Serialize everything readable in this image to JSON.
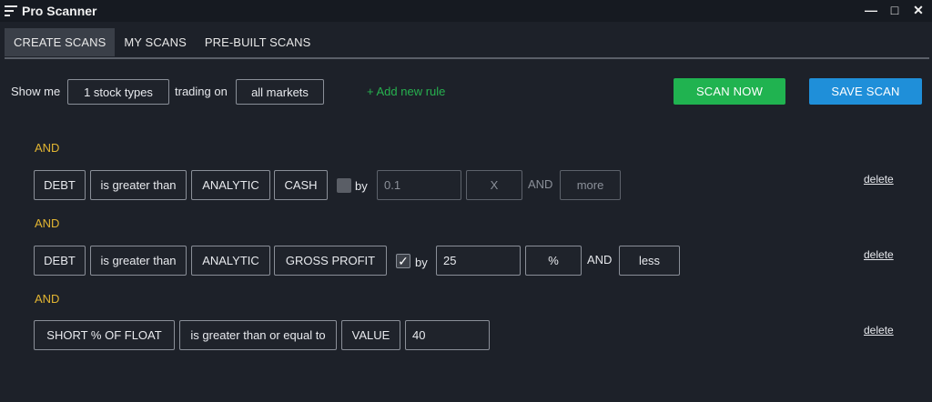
{
  "window": {
    "title": "Pro Scanner",
    "minimize": "—",
    "maximize": "□",
    "close": "✕"
  },
  "tabs": [
    {
      "label": "CREATE SCANS",
      "active": true
    },
    {
      "label": "MY SCANS",
      "active": false
    },
    {
      "label": "PRE-BUILT SCANS",
      "active": false
    }
  ],
  "toolbar": {
    "show_me": "Show me",
    "stock_types": "1 stock types",
    "trading_on": "trading on",
    "markets": "all markets",
    "add_rule": "+ Add new rule",
    "scan_now": "SCAN NOW",
    "save_scan": "SAVE SCAN"
  },
  "rules": [
    {
      "connector": "AND",
      "field": "DEBT",
      "operator": "is greater than",
      "compare_type": "ANALYTIC",
      "compare_field": "CASH",
      "by_checked": false,
      "by_label": "by",
      "by_value": "0.1",
      "unit": "X",
      "and_label": "AND",
      "direction": "more",
      "delete": "delete"
    },
    {
      "connector": "AND",
      "field": "DEBT",
      "operator": "is greater than",
      "compare_type": "ANALYTIC",
      "compare_field": "GROSS PROFIT",
      "by_checked": true,
      "by_label": "by",
      "by_value": "25",
      "unit": "%",
      "and_label": "AND",
      "direction": "less",
      "delete": "delete"
    },
    {
      "connector": "AND",
      "field": "SHORT % OF FLOAT",
      "operator": "is greater than or equal to",
      "compare_type": "VALUE",
      "value": "40",
      "delete": "delete"
    }
  ],
  "colors": {
    "accent_and": "#e2b532",
    "add_rule": "#27b14f",
    "scan_now": "#20b350",
    "save_scan": "#1f8fd9"
  }
}
